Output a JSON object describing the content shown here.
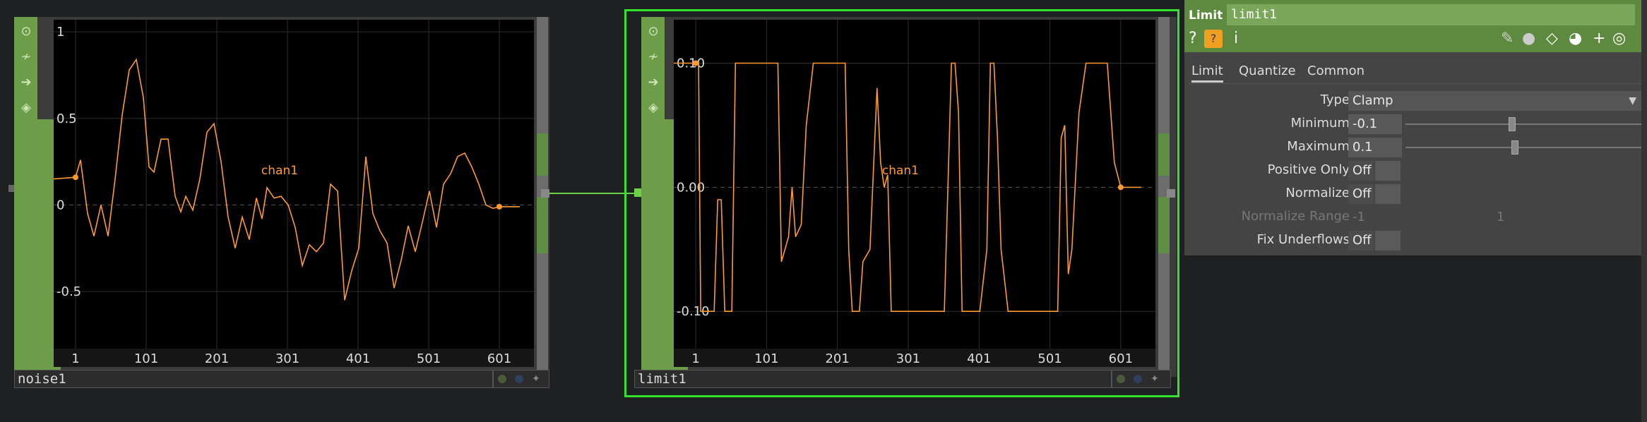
{
  "nodes": [
    {
      "id": "noise1",
      "name": "noise1",
      "chart_data": {
        "type": "line",
        "channel_label": "chan1",
        "xticks": [
          "1",
          "101",
          "201",
          "301",
          "401",
          "501",
          "601"
        ],
        "yticks": [
          {
            "v": 1,
            "label": "1"
          },
          {
            "v": 0.5,
            "label": "0.5"
          },
          {
            "v": 0,
            "label": "0"
          },
          {
            "v": -0.5,
            "label": "-0.5"
          }
        ],
        "xlim": [
          -30,
          650
        ],
        "ylim": [
          -0.83,
          1.07
        ],
        "series": [
          {
            "x": [
              -30,
              1,
              8,
              18,
              27,
              37,
              47,
              57,
              67,
              77,
              87,
              97,
              105,
              112,
              122,
              132,
              142,
              150,
              157,
              167,
              177,
              187,
              197,
              207,
              217,
              227,
              237,
              247,
              257,
              265,
              272,
              282,
              292,
              302,
              312,
              322,
              332,
              342,
              352,
              362,
              372,
              382,
              392,
              402,
              412,
              422,
              432,
              442,
              452,
              462,
              472,
              482,
              492,
              502,
              512,
              522,
              532,
              542,
              552,
              562,
              572,
              582,
              592,
              601,
              630
            ],
            "y": [
              0.15,
              0.16,
              0.26,
              -0.05,
              -0.18,
              0.0,
              -0.18,
              0.15,
              0.52,
              0.78,
              0.84,
              0.62,
              0.22,
              0.19,
              0.38,
              0.38,
              0.05,
              -0.04,
              0.05,
              -0.03,
              0.15,
              0.42,
              0.47,
              0.25,
              -0.07,
              -0.25,
              -0.07,
              -0.2,
              0.04,
              -0.08,
              0.1,
              0.04,
              0.05,
              0.0,
              -0.13,
              -0.35,
              -0.23,
              -0.27,
              -0.22,
              0.12,
              0.08,
              -0.55,
              -0.38,
              -0.25,
              0.28,
              -0.05,
              -0.15,
              -0.22,
              -0.48,
              -0.32,
              -0.12,
              -0.27,
              -0.1,
              0.08,
              -0.13,
              0.12,
              0.18,
              0.28,
              0.3,
              0.22,
              0.12,
              0.0,
              -0.02,
              -0.01,
              -0.01
            ]
          }
        ]
      }
    },
    {
      "id": "limit1",
      "name": "limit1",
      "chart_data": {
        "type": "line",
        "channel_label": "chan1",
        "xticks": [
          "1",
          "101",
          "201",
          "301",
          "401",
          "501",
          "601"
        ],
        "yticks": [
          {
            "v": 0.1,
            "label": "0.10"
          },
          {
            "v": 0,
            "label": "0.00"
          },
          {
            "v": -0.1,
            "label": "-0.10"
          }
        ],
        "xlim": [
          -30,
          650
        ],
        "ylim": [
          -0.13,
          0.135
        ],
        "series": [
          {
            "x": [
              -30,
              1,
              5,
              8,
              12,
              18,
              27,
              32,
              37,
              42,
              47,
              52,
              57,
              67,
              77,
              87,
              97,
              112,
              117,
              122,
              132,
              137,
              142,
              150,
              157,
              167,
              177,
              187,
              197,
              207,
              212,
              217,
              222,
              227,
              232,
              237,
              247,
              257,
              262,
              267,
              272,
              277,
              282,
              292,
              302,
              312,
              322,
              332,
              342,
              352,
              362,
              367,
              372,
              377,
              382,
              392,
              402,
              412,
              417,
              422,
              427,
              432,
              442,
              452,
              462,
              472,
              482,
              492,
              502,
              512,
              517,
              522,
              527,
              532,
              542,
              552,
              562,
              572,
              582,
              592,
              601,
              630
            ],
            "y": [
              0.1,
              0.1,
              0.1,
              -0.1,
              -0.1,
              -0.1,
              -0.1,
              -0.01,
              -0.01,
              -0.1,
              -0.1,
              -0.1,
              0.1,
              0.1,
              0.1,
              0.1,
              0.1,
              0.1,
              0.1,
              -0.06,
              -0.04,
              0.0,
              -0.04,
              -0.03,
              0.05,
              0.1,
              0.1,
              0.1,
              0.1,
              0.1,
              0.1,
              -0.05,
              -0.1,
              -0.1,
              -0.1,
              -0.06,
              -0.05,
              0.08,
              0.02,
              0.0,
              0.01,
              -0.1,
              -0.1,
              -0.1,
              -0.1,
              -0.1,
              -0.1,
              -0.1,
              -0.1,
              -0.1,
              0.1,
              0.1,
              0.06,
              -0.1,
              -0.1,
              -0.1,
              -0.1,
              -0.05,
              0.1,
              0.1,
              0.04,
              -0.05,
              -0.1,
              -0.1,
              -0.1,
              -0.1,
              -0.1,
              -0.1,
              -0.1,
              -0.1,
              0.04,
              0.05,
              -0.07,
              -0.05,
              0.06,
              0.1,
              0.1,
              0.1,
              0.1,
              0.02,
              0.0,
              0.0
            ]
          }
        ]
      }
    }
  ],
  "panel": {
    "op_type": "Limit",
    "op_name": "limit1",
    "icons": [
      "help-icon",
      "python-help-icon",
      "info-icon",
      "edit-icon",
      "comment-icon",
      "clone-icon",
      "python-icon",
      "add-icon",
      "target-icon"
    ],
    "tabs": [
      "Limit",
      "Quantize",
      "Common"
    ],
    "params": [
      {
        "label": "Type",
        "kind": "menu",
        "value": "Clamp"
      },
      {
        "label": "Minimum",
        "kind": "slider",
        "value": "-0.1",
        "slider_pos": 0.45
      },
      {
        "label": "Maximum",
        "kind": "slider",
        "value": "0.1",
        "slider_pos": 0.46
      },
      {
        "label": "Positive Only",
        "kind": "toggle",
        "value": "Off"
      },
      {
        "label": "Normalize",
        "kind": "toggle",
        "value": "Off"
      },
      {
        "label": "Normalize Range",
        "kind": "range",
        "value": "-1",
        "value2": "1",
        "disabled": true
      },
      {
        "label": "Fix Underflows",
        "kind": "toggle",
        "value": "Off"
      }
    ]
  },
  "colors": {
    "accent_green": "#6e9d4a",
    "selection": "#35e02e",
    "curve": "#ff9a2e"
  }
}
